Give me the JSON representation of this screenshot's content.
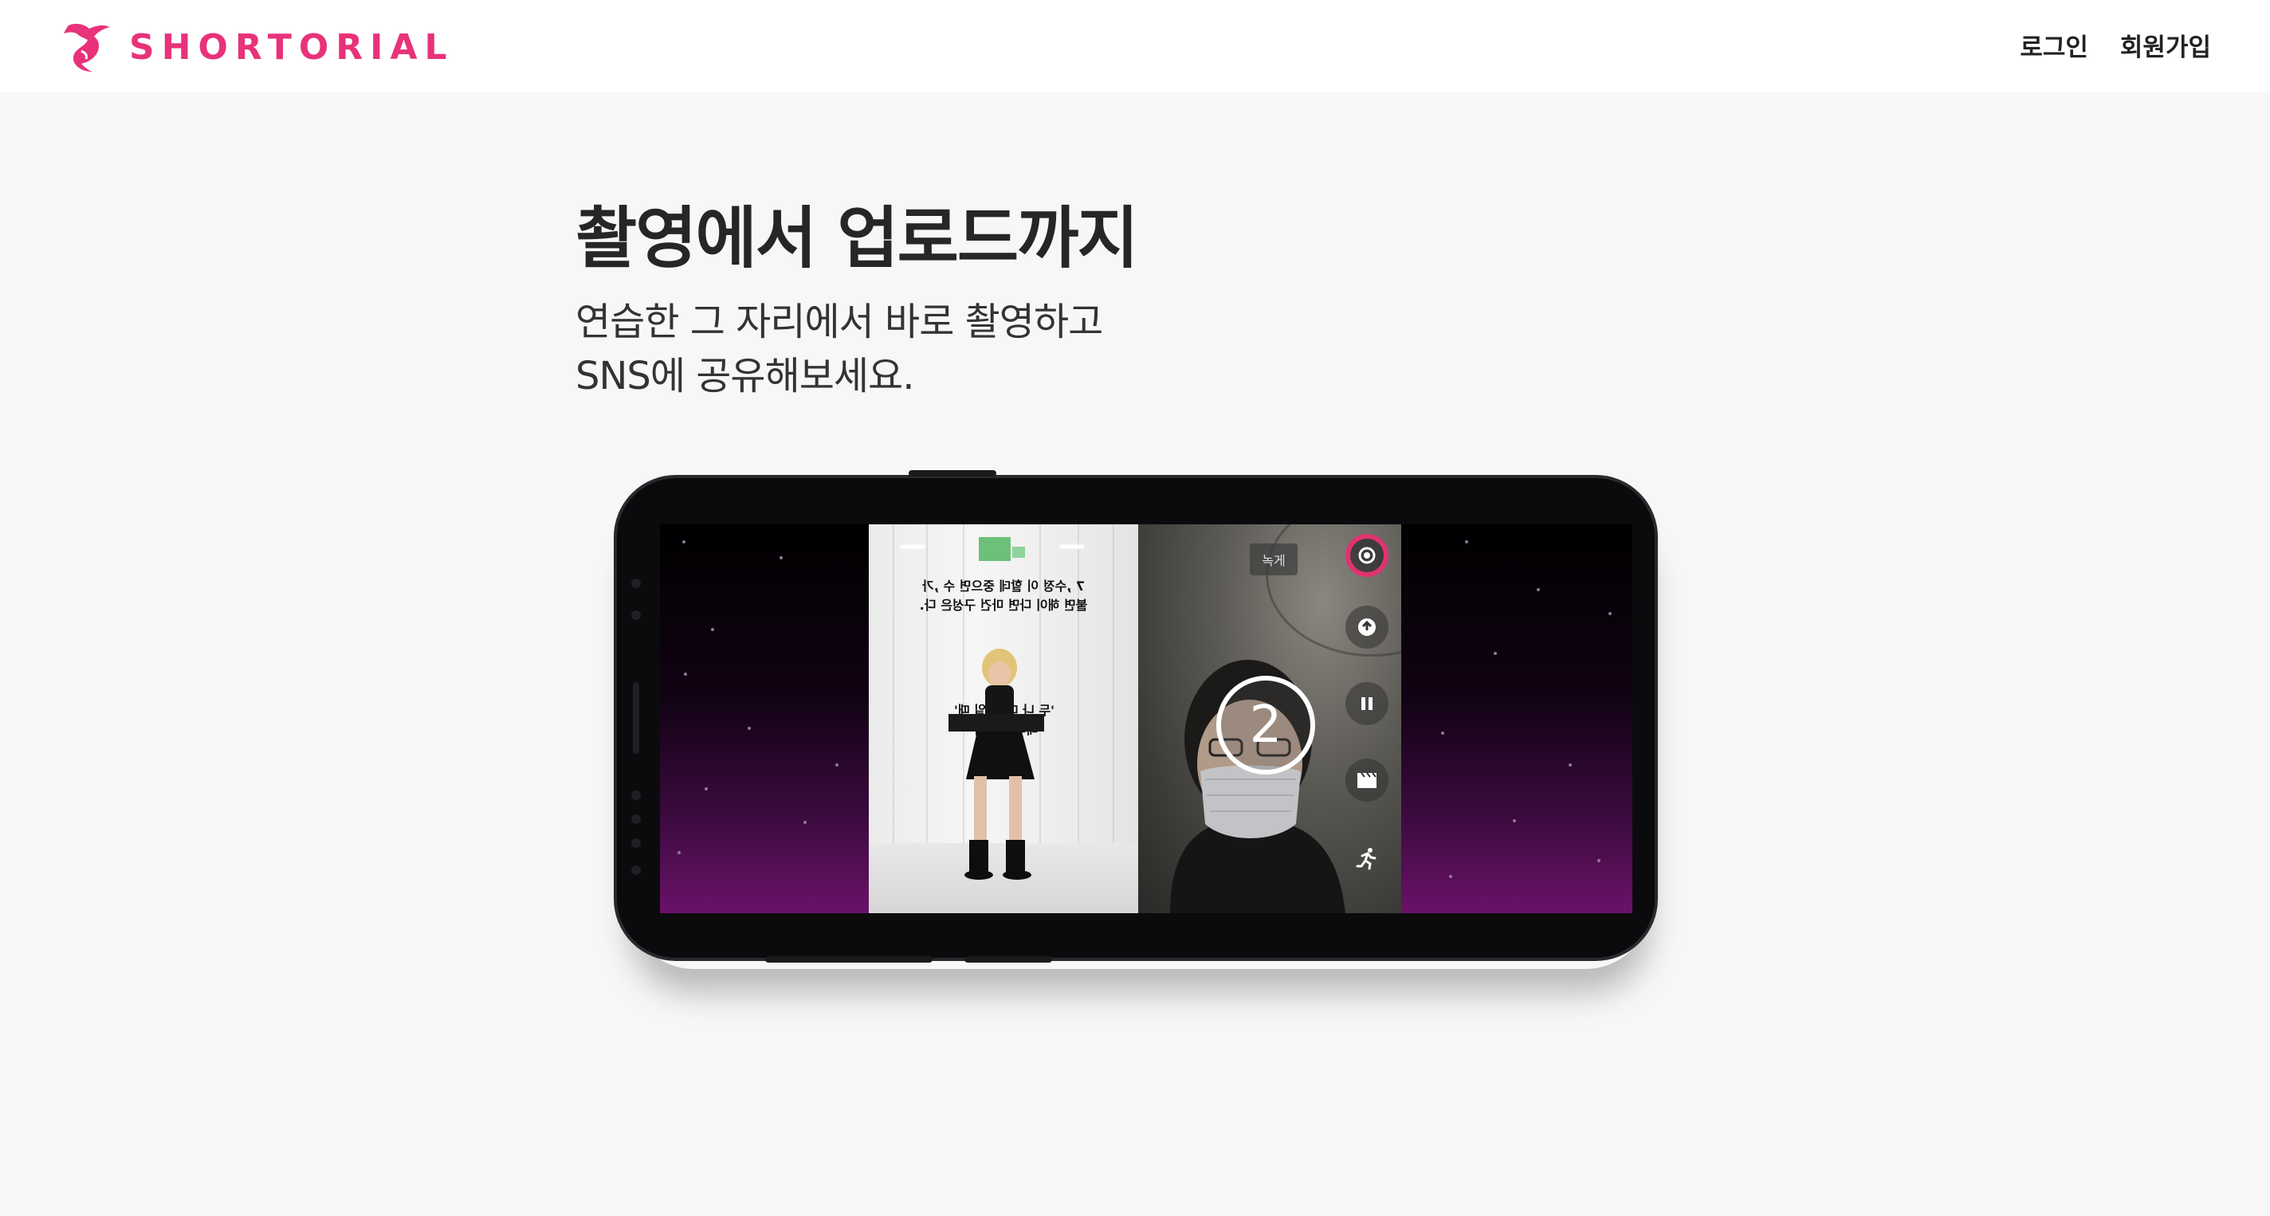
{
  "header": {
    "brand": "SHORTORIAL",
    "logo_icon": "dancer-logo-icon",
    "nav": {
      "login_label": "로그인",
      "signup_label": "회원가입"
    }
  },
  "hero": {
    "title": "촬영에서 업로드까지",
    "subtitle_line1": "연습한 그 자리에서 바로 촬영하고",
    "subtitle_line2": "SNS에 공유해보세요."
  },
  "phone_screen": {
    "countdown_value": "2",
    "camera_label": "녹게",
    "icons": [
      "record-icon",
      "upload-icon",
      "pause-icon",
      "clapperboard-icon",
      "run-icon"
    ],
    "colors": {
      "brand": "#e8327a",
      "screen_gradient_bottom": "#6a1268"
    }
  }
}
